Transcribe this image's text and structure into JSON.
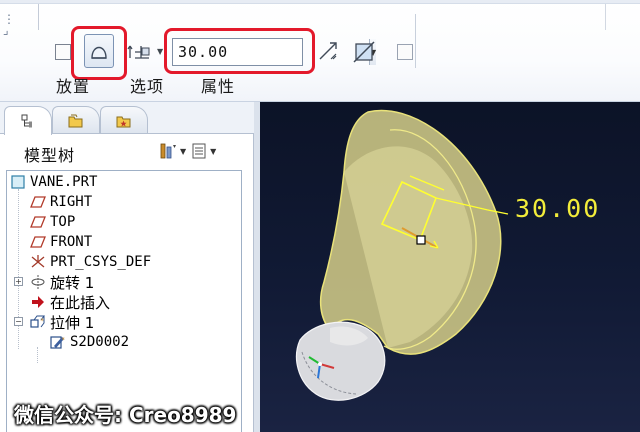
{
  "ribbon": {
    "depth_value": "30.00",
    "tabs": [
      "放置",
      "选项",
      "属性"
    ]
  },
  "panel": {
    "title": "模型树"
  },
  "tree": {
    "items": [
      {
        "label": "VANE.PRT"
      },
      {
        "label": "RIGHT"
      },
      {
        "label": "TOP"
      },
      {
        "label": "FRONT"
      },
      {
        "label": "PRT_CSYS_DEF"
      },
      {
        "label": "旋转 1"
      },
      {
        "label": "在此插入"
      },
      {
        "label": "拉伸 1"
      },
      {
        "label": "S2D0002"
      }
    ]
  },
  "viewport": {
    "dimension_text": "30.00"
  },
  "watermark": "微信公众号: Creo8989",
  "colors": {
    "highlight": "#e3192b",
    "viewport_bg": "#111a35",
    "dimension": "#f2ec3a",
    "surface_fill": "#d8d08a"
  },
  "icons": [
    "solid-icon",
    "surface-icon",
    "depth-icon",
    "dropdown-arrow-icon",
    "flip-direction-icon",
    "thicken-icon",
    "remove-material-icon",
    "model-tree-tab-icon",
    "folder-tab-icon",
    "favorites-tab-icon",
    "tree-settings-icon",
    "tree-columns-icon",
    "part-icon",
    "datum-plane-icon",
    "csys-icon",
    "revolve-icon",
    "insert-here-icon",
    "extrude-icon",
    "sketch-icon"
  ]
}
